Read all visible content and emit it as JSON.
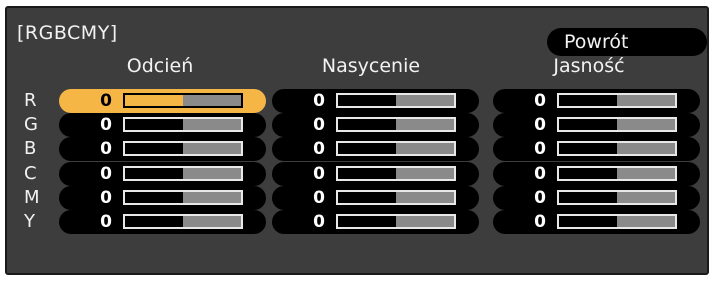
{
  "title": "[RGBCMY]",
  "back_button": "Powrót",
  "columns": [
    "Odcień",
    "Nasycenie",
    "Jasność"
  ],
  "rows": [
    {
      "label": "R",
      "values": [
        0,
        0,
        0
      ]
    },
    {
      "label": "G",
      "values": [
        0,
        0,
        0
      ]
    },
    {
      "label": "B",
      "values": [
        0,
        0,
        0
      ]
    },
    {
      "label": "C",
      "values": [
        0,
        0,
        0
      ]
    },
    {
      "label": "M",
      "values": [
        0,
        0,
        0
      ]
    },
    {
      "label": "Y",
      "values": [
        0,
        0,
        0
      ]
    }
  ],
  "slider_fill_fraction": 0.5,
  "selected": {
    "row": 0,
    "column": 0
  },
  "colors": {
    "panel": "#3d3d3d",
    "highlight": "#f5b646",
    "cell": "#000000"
  }
}
